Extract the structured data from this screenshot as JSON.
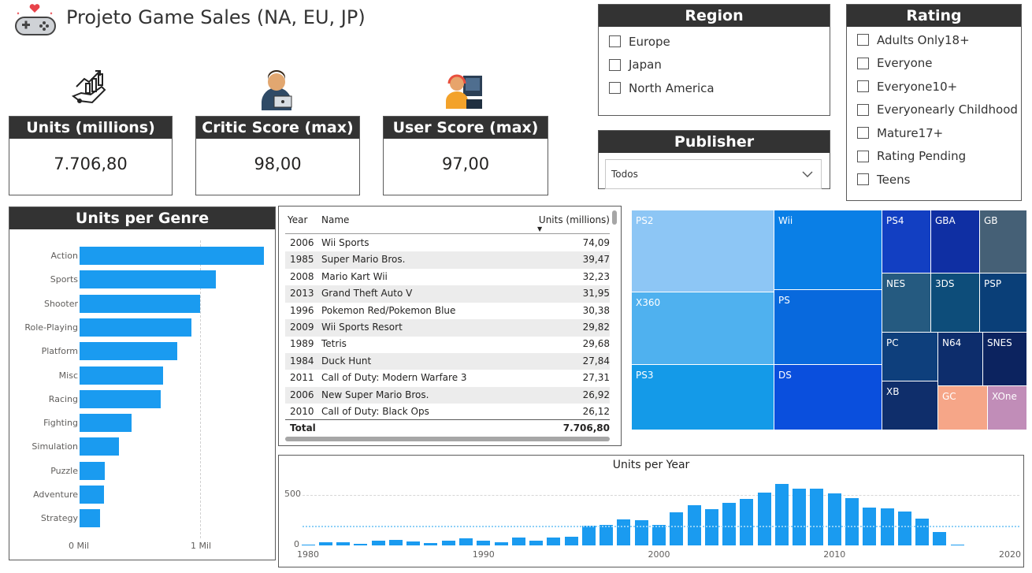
{
  "app": {
    "title": "Projeto Game Sales (NA, EU, JP)",
    "icon": "gamepad-heart-icon"
  },
  "kpis": [
    {
      "label": "Units (millions)",
      "value": "7.706,80",
      "icon": "growth-hand-icon"
    },
    {
      "label": "Critic Score (max)",
      "value": "98,00",
      "icon": "critic-person-icon"
    },
    {
      "label": "User Score (max)",
      "value": "97,00",
      "icon": "gamer-person-icon"
    }
  ],
  "region": {
    "title": "Region",
    "options": [
      "Europe",
      "Japan",
      "North America"
    ]
  },
  "publisher": {
    "title": "Publisher",
    "selected": "Todos"
  },
  "rating": {
    "title": "Rating",
    "options": [
      "Adults Only18+",
      "Everyone",
      "Everyone10+",
      "Everyonearly Childhood",
      "Mature17+",
      "Rating Pending",
      "Teens"
    ]
  },
  "genre_chart": {
    "title": "Units per Genre",
    "axis_labels": [
      "0 Mil",
      "1 Mil"
    ]
  },
  "table": {
    "columns": [
      "Year",
      "Name",
      "Units (millions)"
    ],
    "rows": [
      [
        "2006",
        "Wii Sports",
        "74,09"
      ],
      [
        "1985",
        "Super Mario Bros.",
        "39,47"
      ],
      [
        "2008",
        "Mario Kart Wii",
        "32,23"
      ],
      [
        "2013",
        "Grand Theft Auto V",
        "31,95"
      ],
      [
        "1996",
        "Pokemon Red/Pokemon Blue",
        "30,38"
      ],
      [
        "2009",
        "Wii Sports Resort",
        "29,82"
      ],
      [
        "1989",
        "Tetris",
        "29,68"
      ],
      [
        "1984",
        "Duck Hunt",
        "27,84"
      ],
      [
        "2011",
        "Call of Duty: Modern Warfare 3",
        "27,31"
      ],
      [
        "2006",
        "New Super Mario Bros.",
        "26,92"
      ],
      [
        "2010",
        "Call of Duty: Black Ops",
        "26,12"
      ]
    ],
    "total_label": "Total",
    "total_value": "7.706,80"
  },
  "treemap": {
    "tiles": [
      "PS2",
      "Wii",
      "PS4",
      "GBA",
      "GB",
      "X360",
      "PS",
      "NES",
      "3DS",
      "PSP",
      "PS3",
      "DS",
      "PC",
      "N64",
      "SNES",
      "XB",
      "GC",
      "XOne"
    ],
    "colors": {
      "PS2": "#8dc6f5",
      "X360": "#4fb1ef",
      "PS3": "#149ae8",
      "Wii": "#0a7fe6",
      "PS": "#0869dd",
      "DS": "#0a4fdd",
      "PS4": "#123fc2",
      "GBA": "#0f2fa3",
      "GB": "#456076",
      "NES": "#255a80",
      "3DS": "#0d4d7a",
      "PSP": "#0a3f78",
      "PC": "#0e3f7c",
      "N64": "#0d2d6c",
      "SNES": "#0c235f",
      "XB": "#0f2e6b",
      "GC": "#f6a688",
      "XOne": "#c18db8"
    }
  },
  "chart_data": [
    {
      "type": "bar",
      "title": "Units per Genre",
      "orientation": "horizontal",
      "categories": [
        "Action",
        "Sports",
        "Shooter",
        "Role-Playing",
        "Platform",
        "Misc",
        "Racing",
        "Fighting",
        "Simulation",
        "Puzzle",
        "Adventure",
        "Strategy"
      ],
      "values": [
        1.53,
        1.13,
        1.0,
        0.93,
        0.81,
        0.69,
        0.67,
        0.43,
        0.33,
        0.21,
        0.2,
        0.17
      ],
      "xlabel": "",
      "ylabel": "",
      "xlim": [
        0,
        1.55
      ],
      "tick_labels": [
        "0 Mil",
        "1 Mil"
      ]
    },
    {
      "type": "bar",
      "title": "Units per Year",
      "x": [
        1980,
        1981,
        1982,
        1983,
        1984,
        1985,
        1986,
        1987,
        1988,
        1989,
        1990,
        1991,
        1992,
        1993,
        1994,
        1995,
        1996,
        1997,
        1998,
        1999,
        2000,
        2001,
        2002,
        2003,
        2004,
        2005,
        2006,
        2007,
        2008,
        2009,
        2010,
        2011,
        2012,
        2013,
        2014,
        2015,
        2016,
        2017,
        2018,
        2019,
        2020
      ],
      "values": [
        11,
        35,
        28,
        16,
        50,
        53,
        37,
        21,
        47,
        73,
        49,
        32,
        76,
        46,
        79,
        88,
        199,
        201,
        255,
        251,
        200,
        331,
        395,
        357,
        420,
        458,
        520,
        611,
        565,
        559,
        516,
        468,
        372,
        368,
        339,
        268,
        131,
        8,
        0,
        0,
        0
      ],
      "ylim": [
        0,
        650
      ],
      "y_ticks": [
        "0",
        "500"
      ],
      "x_ticks": [
        "1980",
        "1990",
        "2000",
        "2010",
        "2020"
      ],
      "average_line": 198
    }
  ]
}
